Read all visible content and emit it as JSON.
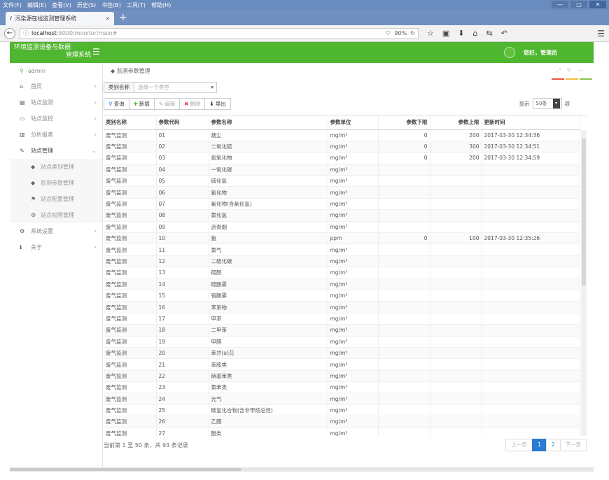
{
  "browser": {
    "menu": [
      "文件(F)",
      "编辑(E)",
      "查看(V)",
      "历史(S)",
      "书签(B)",
      "工具(T)",
      "帮助(H)"
    ],
    "tab_title": "污染源在线监测管理系统",
    "url_host": "localhost",
    "url_path": ":8000/monitor/main#",
    "zoom": "90%"
  },
  "header": {
    "title_line1": "环境监测设备与数据",
    "title_line2": "管理系统",
    "greeting": "您好，管理员"
  },
  "sidebar": {
    "user": "admin",
    "items": [
      {
        "icon": "home-icon",
        "glyph": "⌂",
        "label": "首页"
      },
      {
        "icon": "monitor-icon",
        "glyph": "▤",
        "label": "站点监测"
      },
      {
        "icon": "display-icon",
        "glyph": "▭",
        "label": "站点监控"
      },
      {
        "icon": "chart-icon",
        "glyph": "▥",
        "label": "分析报表"
      },
      {
        "icon": "wrench-icon",
        "glyph": "✎",
        "label": "站点管理"
      }
    ],
    "subitems": [
      {
        "icon": "tag-icon",
        "glyph": "◆",
        "label": "站点类别管理"
      },
      {
        "icon": "tag-icon",
        "glyph": "◆",
        "label": "监测参数管理"
      },
      {
        "icon": "flag-icon",
        "glyph": "⚑",
        "label": "站点配置管理"
      },
      {
        "icon": "cogs-icon",
        "glyph": "⚙",
        "label": "站点权限管理"
      }
    ],
    "items2": [
      {
        "icon": "gear-icon",
        "glyph": "⚙",
        "label": "系统设置"
      },
      {
        "icon": "info-icon",
        "glyph": "ℹ",
        "label": "关于"
      }
    ]
  },
  "main": {
    "breadcrumb": "监测参数管理",
    "filter_label": "类别名称",
    "filter_placeholder": "选择一个类型",
    "toolbar": {
      "query": "查询",
      "add": "新增",
      "edit": "编辑",
      "delete": "删除",
      "export": "导出"
    },
    "page_size_prefix": "显示",
    "page_size_value": "50条",
    "page_size_suffix": "项",
    "accent_colors": [
      "#e9573f",
      "#f6bb42",
      "#8cc152"
    ],
    "columns": [
      "类别名称",
      "参数代码",
      "参数名称",
      "参数单位",
      "参数下限",
      "参数上限",
      "更新时间"
    ],
    "rows": [
      [
        "废气监测",
        "01",
        "烟尘",
        "mg/m³",
        "0",
        "200",
        "2017-03-30 12:34:36"
      ],
      [
        "废气监测",
        "02",
        "二氧化硫",
        "mg/m³",
        "0",
        "300",
        "2017-03-30 12:34:51"
      ],
      [
        "废气监测",
        "03",
        "氮氧化物",
        "mg/m³",
        "0",
        "200",
        "2017-03-30 12:34:59"
      ],
      [
        "废气监测",
        "04",
        "一氧化碳",
        "mg/m³",
        "",
        "",
        ""
      ],
      [
        "废气监测",
        "05",
        "硫化氢",
        "mg/m³",
        "",
        "",
        ""
      ],
      [
        "废气监测",
        "06",
        "氟化物",
        "mg/m³",
        "",
        "",
        ""
      ],
      [
        "废气监测",
        "07",
        "氰化物(含氰化氢)",
        "mg/m³",
        "",
        "",
        ""
      ],
      [
        "废气监测",
        "08",
        "氯化氢",
        "mg/m³",
        "",
        "",
        ""
      ],
      [
        "废气监测",
        "09",
        "沥青烟",
        "mg/m³",
        "",
        "",
        ""
      ],
      [
        "废气监测",
        "10",
        "氨",
        "ppm",
        "0",
        "100",
        "2017-03-30 12:35:26"
      ],
      [
        "废气监测",
        "11",
        "氯气",
        "mg/m³",
        "",
        "",
        ""
      ],
      [
        "废气监测",
        "12",
        "二硫化碳",
        "mg/m³",
        "",
        "",
        ""
      ],
      [
        "废气监测",
        "13",
        "硫醇",
        "mg/m³",
        "",
        "",
        ""
      ],
      [
        "废气监测",
        "14",
        "硫酸雾",
        "mg/m³",
        "",
        "",
        ""
      ],
      [
        "废气监测",
        "15",
        "铬酸雾",
        "mg/m³",
        "",
        "",
        ""
      ],
      [
        "废气监测",
        "16",
        "苯系物",
        "mg/m³",
        "",
        "",
        ""
      ],
      [
        "废气监测",
        "17",
        "甲苯",
        "mg/m³",
        "",
        "",
        ""
      ],
      [
        "废气监测",
        "18",
        "二甲苯",
        "mg/m³",
        "",
        "",
        ""
      ],
      [
        "废气监测",
        "19",
        "甲醛",
        "mg/m³",
        "",
        "",
        ""
      ],
      [
        "废气监测",
        "20",
        "苯并(a)芘",
        "mg/m³",
        "",
        "",
        ""
      ],
      [
        "废气监测",
        "21",
        "苯胺类",
        "mg/m³",
        "",
        "",
        ""
      ],
      [
        "废气监测",
        "22",
        "硝基苯类",
        "mg/m³",
        "",
        "",
        ""
      ],
      [
        "废气监测",
        "23",
        "氯苯类",
        "mg/m³",
        "",
        "",
        ""
      ],
      [
        "废气监测",
        "24",
        "光气",
        "mg/m³",
        "",
        "",
        ""
      ],
      [
        "废气监测",
        "25",
        "碳氢化合物(含非甲烷总烃)",
        "mg/m³",
        "",
        "",
        ""
      ],
      [
        "废气监测",
        "26",
        "乙醛",
        "mg/m³",
        "",
        "",
        ""
      ],
      [
        "废气监测",
        "27",
        "酚类",
        "mg/m³",
        "",
        "",
        ""
      ]
    ],
    "footer_info": "当前第 1 至 50 条，共 93 条记录",
    "pager": {
      "prev": "上一页",
      "pages": [
        "1",
        "2"
      ],
      "next": "下一页"
    }
  }
}
